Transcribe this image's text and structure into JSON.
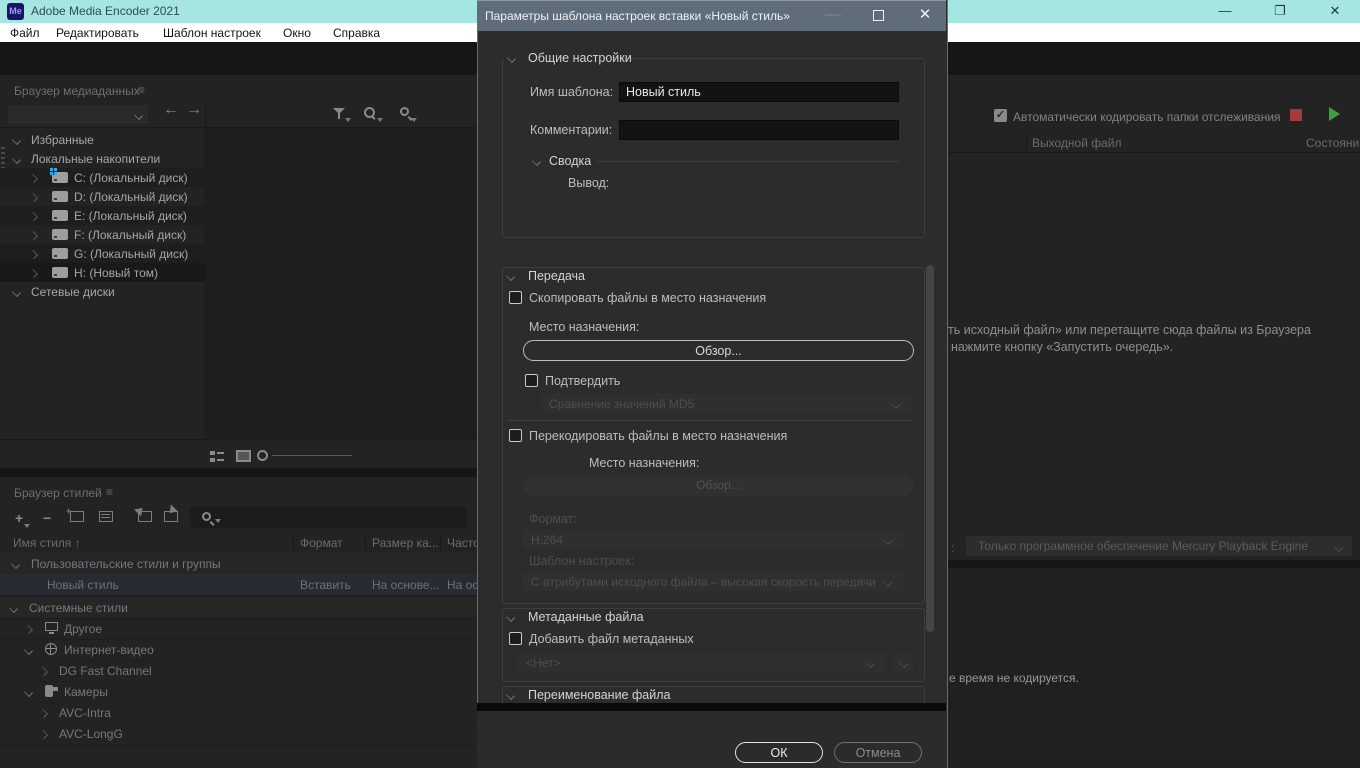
{
  "app": {
    "logo_text": "Me",
    "title": "Adobe Media Encoder 2021",
    "menus": [
      "Файл",
      "Редактировать",
      "Шаблон настроек",
      "Окно",
      "Справка"
    ],
    "window_buttons": [
      "minimize",
      "maximize",
      "close"
    ]
  },
  "media_browser": {
    "title": "Браузер медиаданных",
    "tree": [
      {
        "label": "Избранные",
        "level": 0,
        "chev": "d",
        "icon": ""
      },
      {
        "label": "Локальные накопители",
        "level": 0,
        "chev": "d",
        "icon": ""
      },
      {
        "label": "C: (Локальный диск)",
        "level": 1,
        "chev": "r",
        "icon": "drive-system",
        "stripe": true
      },
      {
        "label": "D: (Локальный диск)",
        "level": 1,
        "chev": "r",
        "icon": "drive",
        "stripe": false
      },
      {
        "label": "E: (Локальный диск)",
        "level": 1,
        "chev": "r",
        "icon": "drive",
        "stripe": true
      },
      {
        "label": "F: (Локальный диск)",
        "level": 1,
        "chev": "r",
        "icon": "drive",
        "stripe": false
      },
      {
        "label": "G: (Локальный диск)",
        "level": 1,
        "chev": "r",
        "icon": "drive",
        "stripe": true
      },
      {
        "label": "H: (Новый том)",
        "level": 1,
        "chev": "r",
        "icon": "drive",
        "stripe": true
      },
      {
        "label": "Сетевые диски",
        "level": 0,
        "chev": "d",
        "icon": ""
      }
    ]
  },
  "preset_browser": {
    "title": "Браузер стилей",
    "columns": [
      "Имя стиля",
      "Формат",
      "Размер ка...",
      "Часто"
    ],
    "rows": [
      {
        "label": "Пользовательские стили и группы",
        "type": "group",
        "chev": "d",
        "indent": 12,
        "cells": [
          "",
          "",
          ""
        ]
      },
      {
        "label": "Новый стиль",
        "type": "selected",
        "chev": "",
        "indent": 47,
        "cells": [
          "Вставить",
          "На основе...",
          "На ос"
        ]
      },
      {
        "label": "Системные стили",
        "type": "group",
        "chev": "d",
        "indent": 10,
        "cells": [
          "",
          "",
          ""
        ]
      },
      {
        "label": "Другое",
        "type": "item",
        "chev": "r",
        "indent": 25,
        "icon": "monitor",
        "cells": [
          "",
          "",
          ""
        ]
      },
      {
        "label": "Интернет-видео",
        "type": "item",
        "chev": "d",
        "indent": 25,
        "icon": "globe",
        "cells": [
          "",
          "",
          ""
        ]
      },
      {
        "label": "DG Fast Channel",
        "type": "item",
        "chev": "r",
        "indent": 40,
        "cells": [
          "",
          "",
          ""
        ]
      },
      {
        "label": "Камеры",
        "type": "item",
        "chev": "d",
        "indent": 25,
        "icon": "camera",
        "cells": [
          "",
          "",
          ""
        ]
      },
      {
        "label": "AVC-Intra",
        "type": "item",
        "chev": "r",
        "indent": 40,
        "cells": [
          "",
          "",
          ""
        ]
      },
      {
        "label": "AVC-LongG",
        "type": "item",
        "chev": "r",
        "indent": 40,
        "cells": [
          "",
          "",
          ""
        ]
      }
    ]
  },
  "queue": {
    "auto_encode_label": "Автоматически кодировать папки отслеживания",
    "auto_encode_checked": true,
    "check_glyph": "✓",
    "columns": [
      "Выходной файл",
      "Состояни"
    ],
    "hint_line1": "ть исходный файл» или перетащите сюда файлы из Браузера",
    "hint_line2": "нажмите кнопку «Запустить очередь».",
    "renderer_colon": ":",
    "renderer_value": "Только программное обеспечение Mercury Playback Engine",
    "status_text": "е время не кодируется."
  },
  "dialog": {
    "title": "Параметры шаблона настроек вставки «Новый стиль»",
    "general": {
      "header": "Общие настройки",
      "name_label": "Имя шаблона:",
      "name_value": "Новый стиль",
      "comments_label": "Комментарии:",
      "comments_value": "",
      "summary_header": "Сводка",
      "output_label": "Вывод:"
    },
    "transfer": {
      "header": "Передача",
      "copy_label": "Скопировать файлы в место назначения",
      "dest_label": "Место назначения:",
      "browse_label": "Обзор...",
      "verify_label": "Подтвердить",
      "verify_value": "Сравнение значений MD5",
      "transcode_label": "Перекодировать файлы в место назначения",
      "dest2_label": "Место назначения:",
      "browse2_label": "Обзор...",
      "format_label": "Формат:",
      "format_value": "H.264",
      "preset_label": "Шаблон настроек:",
      "preset_value": "С атрибутами исходного файла – высокая скорость передачи"
    },
    "metadata": {
      "header": "Метаданные файла",
      "add_label": "Добавить файл метаданных",
      "value": "<Нет>"
    },
    "rename": {
      "header": "Переименование файла"
    },
    "ok_label": "ОК",
    "cancel_label": "Отмена"
  }
}
